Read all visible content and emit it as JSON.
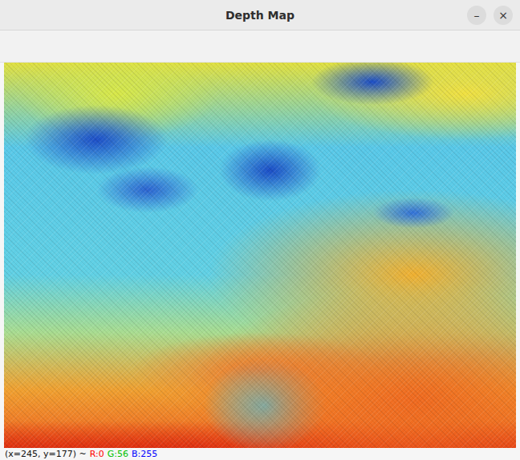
{
  "window": {
    "title": "Depth Map",
    "controls": [
      {
        "name": "minimize",
        "glyph": "–"
      },
      {
        "name": "close",
        "glyph": "×"
      }
    ]
  },
  "image": {
    "kind": "depth-colormap"
  },
  "status_bar": {
    "prefix": "(x=245, y=177) ~",
    "channels": [
      {
        "label": "R:0",
        "color": "#ff0000"
      },
      {
        "label": "G:56",
        "color": "#00c000"
      },
      {
        "label": "B:255",
        "color": "#0000ff"
      }
    ]
  }
}
